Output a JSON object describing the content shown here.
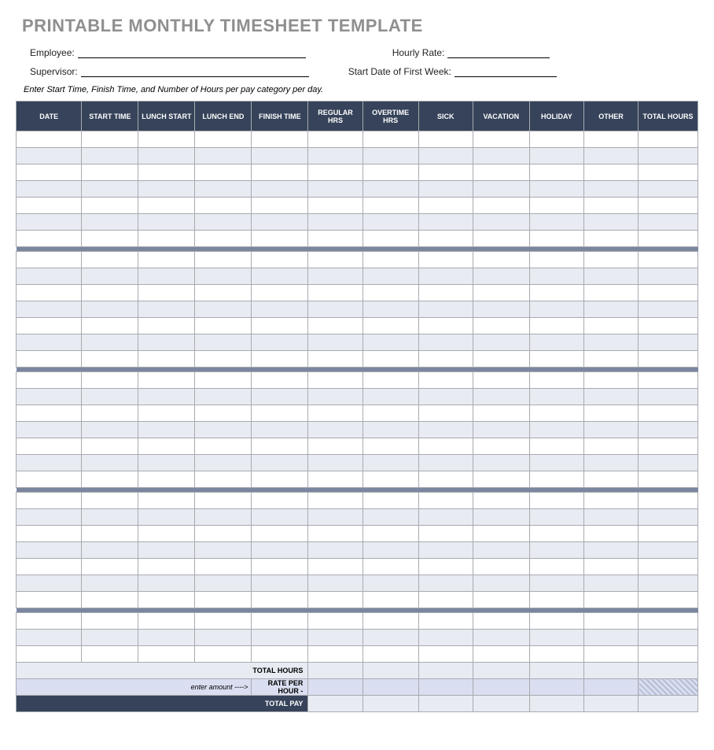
{
  "title": "PRINTABLE MONTHLY TIMESHEET TEMPLATE",
  "info": {
    "employee_label": "Employee:",
    "hourly_rate_label": "Hourly Rate:",
    "supervisor_label": "Supervisor:",
    "start_date_label": "Start Date of First Week:"
  },
  "instructions": "Enter Start Time, Finish Time, and Number of Hours per pay category per day.",
  "columns": [
    "DATE",
    "START TIME",
    "LUNCH START",
    "LUNCH END",
    "FINISH TIME",
    "REGULAR HRS",
    "OVERTIME HRS",
    "SICK",
    "VACATION",
    "HOLIDAY",
    "OTHER",
    "TOTAL HOURS"
  ],
  "weeks": [
    {
      "days": 7
    },
    {
      "days": 7
    },
    {
      "days": 7
    },
    {
      "days": 7
    },
    {
      "days": 3
    }
  ],
  "summary": {
    "total_hours_label": "TOTAL HOURS",
    "rate_hint": "enter amount ---->",
    "rate_label": "RATE PER HOUR -",
    "total_pay_label": "TOTAL PAY"
  }
}
